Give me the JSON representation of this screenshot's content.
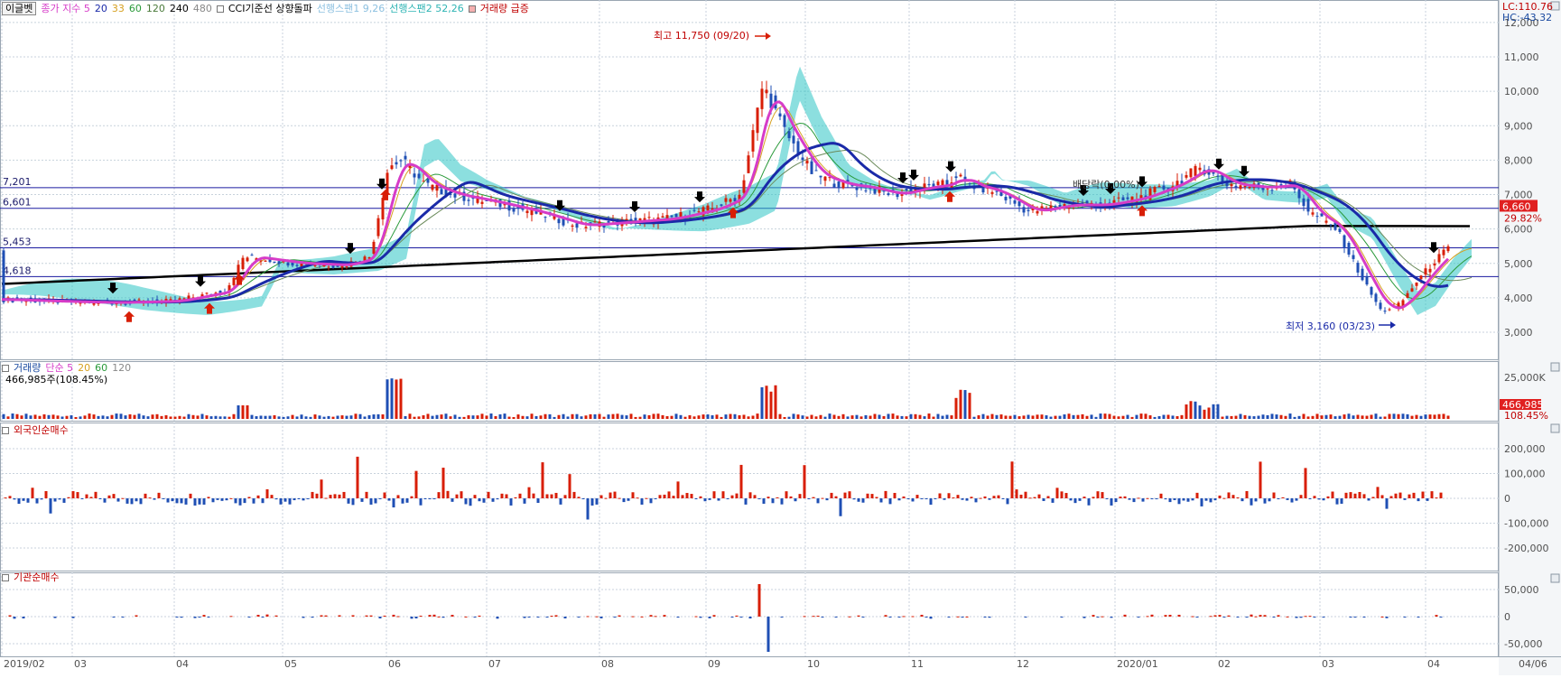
{
  "colors": {
    "grid": "#c8d2dc",
    "axis_text": "#505050",
    "price_up": "#d81e06",
    "price_down": "#1f4fb4",
    "ma5": "#d63cc8",
    "ma20": "#1a2aa8",
    "ma33": "#d6a020",
    "ma60": "#2a9a3a",
    "ma120": "#6a8a5a",
    "ma240": "#000000",
    "cloud_lead1": "#2ec4c4",
    "cloud_lead2": "#8cc0f0",
    "level_line": "#1a1aa0"
  },
  "price_legend": {
    "settings_button": "이글벳",
    "close_index": "종가 지수 5",
    "ma20": "20",
    "ma33": "33",
    "ma60": "60",
    "ma120": "120",
    "ma240": "240",
    "ma480": "480",
    "cci": "CCI기준선 상향돌파",
    "span1": "선행스팬1 9,26",
    "span2": "선행스팬2 52,26",
    "volume_surge": "거래량 급증"
  },
  "price_readout": {
    "lc": "LC:110.76",
    "hc": "HC:-43.32"
  },
  "volume_legend": {
    "title": "거래량",
    "simple": "단순 5",
    "ma20": "20",
    "ma60": "60",
    "ma120": "120",
    "value": "466,985주(108.45%)"
  },
  "foreign_legend": {
    "title": "외국인순매수"
  },
  "institution_legend": {
    "title": "기관순매수"
  },
  "annotations": {
    "high": "최고 11,750 (09/20)",
    "low": "최저 3,160 (03/23)",
    "dividend": "배당락(0.00%)"
  },
  "price_axis_ticks": [
    "12,000",
    "11,000",
    "10,000",
    "9,000",
    "8,000",
    "7,000",
    "6,000",
    "5,000",
    "4,000",
    "3,000"
  ],
  "level_lines": [
    {
      "label": "7,201",
      "value": 7201
    },
    {
      "label": "6,601",
      "value": 6601
    },
    {
      "label": "5,453",
      "value": 5453
    },
    {
      "label": "4,618",
      "value": 4618
    }
  ],
  "current_price_badge": "6,660",
  "current_pct_label": "29.82%",
  "volume_axis_ticks": [
    "25,000K"
  ],
  "volume_badge": "466,985",
  "volume_pct_label": "108.45%",
  "foreign_axis_ticks": [
    "200,000",
    "100,000",
    "0",
    "-100,000",
    "-200,000"
  ],
  "institution_axis_ticks": [
    "50,000",
    "0",
    "-50,000"
  ],
  "date_labels": [
    "2019/02",
    "03",
    "04",
    "05",
    "06",
    "07",
    "08",
    "09",
    "10",
    "11",
    "12",
    "2020/01",
    "02",
    "03",
    "04",
    "04/06"
  ],
  "chart_data": {
    "type": "candlestick",
    "title": "",
    "xlabel": "",
    "ylabel": "",
    "ylim": [
      2500,
      12500
    ],
    "x_range": [
      "2019/02",
      "2020/04/06"
    ],
    "last_close": 6660,
    "high": {
      "value": 11750,
      "date": "09/20"
    },
    "low": {
      "value": 3160,
      "date": "03/23"
    },
    "panels": [
      {
        "name": "price",
        "ylim": [
          2500,
          12500
        ]
      },
      {
        "name": "거래량",
        "last": 466985,
        "pct": 108.45
      },
      {
        "name": "외국인순매수",
        "ylim": [
          -300000,
          300000
        ]
      },
      {
        "name": "기관순매수",
        "ylim": [
          -75000,
          75000
        ]
      }
    ]
  }
}
